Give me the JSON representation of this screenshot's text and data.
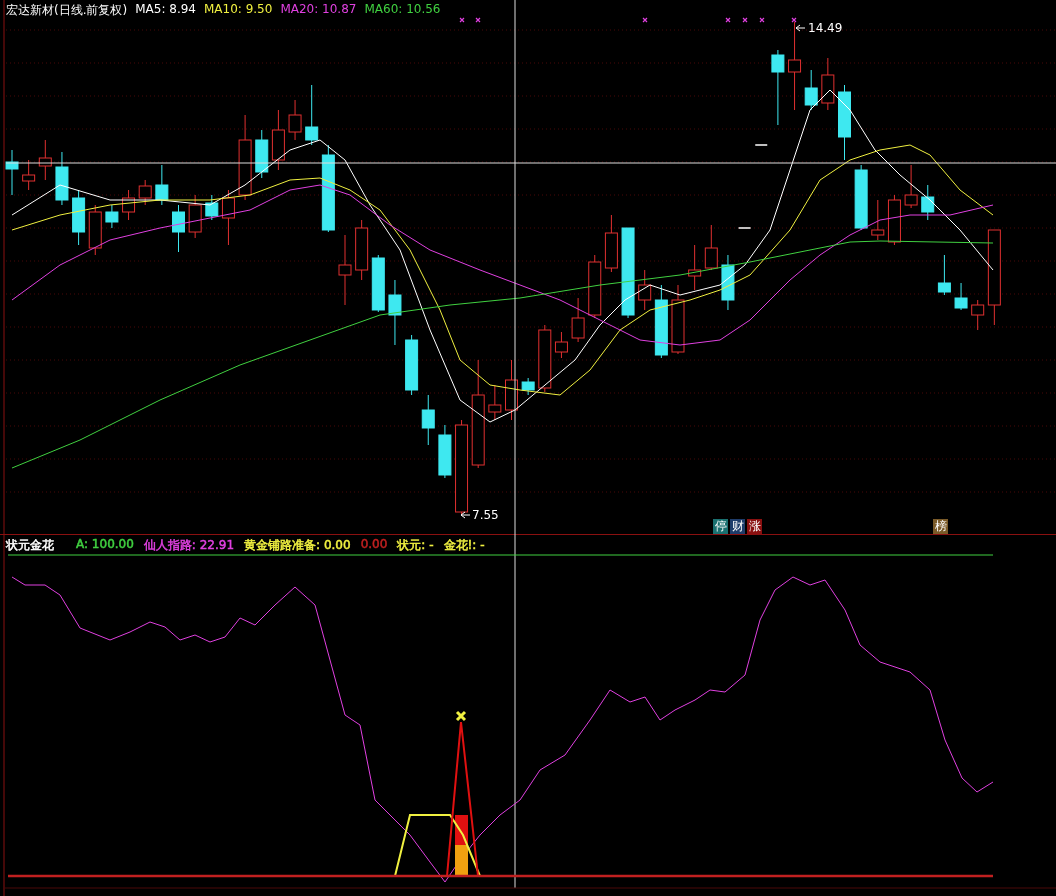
{
  "price_panel": {
    "title": "宏达新材(日线.前复权)",
    "indicators": [
      {
        "label": "MA5: 8.94",
        "color": "#ffffff"
      },
      {
        "label": "MA10: 9.50",
        "color": "#f0f040"
      },
      {
        "label": "MA20: 10.87",
        "color": "#e040e0"
      },
      {
        "label": "MA60: 10.56",
        "color": "#40d040"
      }
    ],
    "high_label": "14.49",
    "low_label": "7.55",
    "badges": [
      {
        "text": "停",
        "color": "#1a7070"
      },
      {
        "text": "财",
        "color": "#1e3c6a"
      },
      {
        "text": "涨",
        "color": "#8a1010"
      },
      {
        "text": "榜",
        "color": "#7a5a28"
      }
    ]
  },
  "indicator_panel": {
    "title": "状元金花",
    "values": [
      {
        "label": "A: 100.00",
        "color": "#40d040"
      },
      {
        "label": "仙人指路: 22.91",
        "color": "#e040e0"
      },
      {
        "label": "黄金铺路准备: 0.00",
        "color": "#f0f040"
      },
      {
        "label": "0.00",
        "color": "#c02020"
      },
      {
        "label": "状元: -",
        "color": "#f0f040"
      },
      {
        "label": "金花!: -",
        "color": "#f0f040"
      }
    ]
  }
}
